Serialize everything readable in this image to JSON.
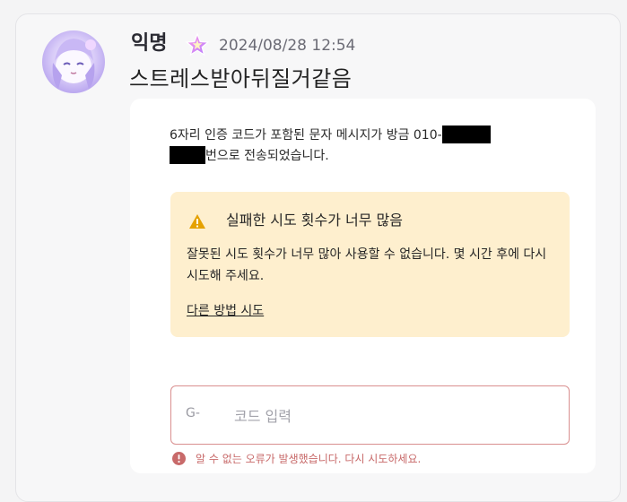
{
  "post": {
    "author": "익명",
    "badge_icon": "sparkle-star-icon",
    "timestamp": "2024/08/28 12:54",
    "text": "스트레스받아뒤질거같음"
  },
  "verification": {
    "sms_message_part1": "6자리 인증 코드가 포함된 문자 메시지가 방금 010-",
    "sms_message_part2": "번으로 전송되었습니다.",
    "warning": {
      "icon": "warning-triangle-icon",
      "title": "실패한 시도 횟수가 너무 많음",
      "body": "잘못된 시도 횟수가 너무 많아 사용할 수 없습니다. 몇 시간 후에 다시 시도해 주세요.",
      "link": "다른 방법 시도"
    },
    "code_input": {
      "prefix": "G-",
      "placeholder": "코드 입력",
      "value": ""
    },
    "error": {
      "icon": "error-circle-icon",
      "text": "알 수 없는 오류가 발생했습니다. 다시 시도하세요."
    }
  },
  "colors": {
    "warning_bg": "#feefce",
    "warning_icon": "#e5a100",
    "error": "#c86a6a",
    "error_border": "#d98f8f"
  }
}
